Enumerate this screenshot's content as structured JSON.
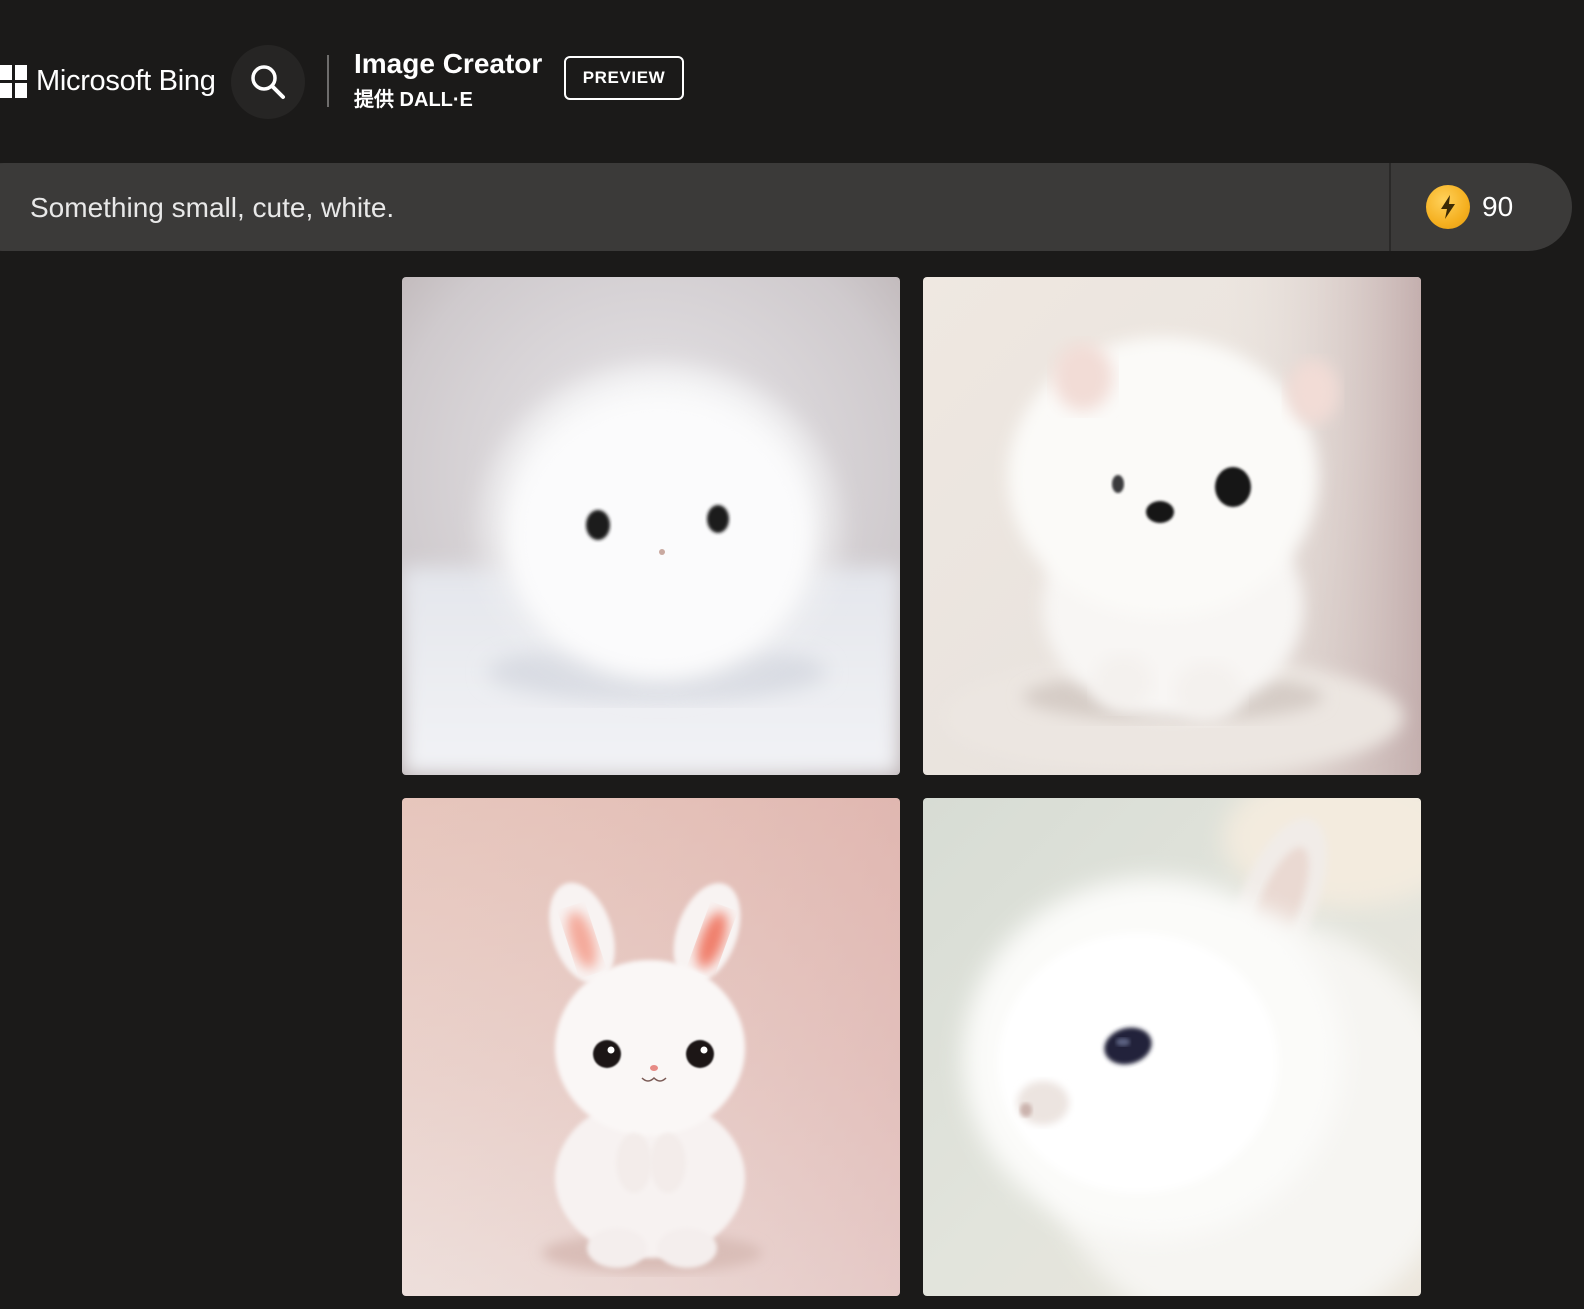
{
  "header": {
    "brand": "Microsoft Bing",
    "app_title": "Image Creator",
    "app_subtitle": "提供 DALL·E",
    "badge": "PREVIEW"
  },
  "prompt": {
    "value": "Something small, cute, white."
  },
  "boosts": {
    "count": "90",
    "icon": "lightning-coin-icon"
  },
  "colors": {
    "background": "#1b1a19",
    "bar": "#3b3a39",
    "coin": "#f5b020"
  },
  "results": [
    {
      "icon": "white-fluffball-image"
    },
    {
      "icon": "white-puppy-image"
    },
    {
      "icon": "white-bunny-figurine-image"
    },
    {
      "icon": "white-baby-rabbit-image"
    }
  ]
}
